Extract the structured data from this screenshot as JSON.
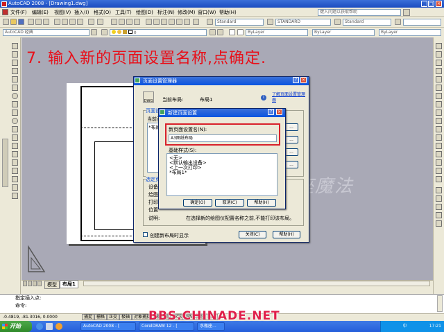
{
  "app": {
    "title": "AutoCAD 2008 - [Drawing1.dwg]",
    "search_placeholder": "键入问题以获取帮助"
  },
  "menu": [
    "文件(F)",
    "编辑(E)",
    "视图(V)",
    "插入(I)",
    "格式(O)",
    "工具(T)",
    "绘图(D)",
    "标注(N)",
    "修改(M)",
    "窗口(W)",
    "帮助(H)"
  ],
  "toolbar2": {
    "workspace": "AutoCAD 经典",
    "layer": "ByLayer",
    "style1": "Standard",
    "style2": "STANDARD",
    "style3": "Standard",
    "linetype": "ByLayer",
    "lineweight": "ByLayer"
  },
  "heading": "7. 输入新的页面设置名称,点确定.",
  "page_setup_dialog": {
    "title": "页面设置管理器",
    "current_layout_label": "当前布局:",
    "current_layout_value": "布局1",
    "help_link": "了解页面设置管理器",
    "page_setup_group": "页面设置",
    "current_page_setup_label": "当前页",
    "list_item": "*布局",
    "side_buttons": [
      "...",
      "...",
      "...",
      "..."
    ],
    "selected_group": "选定页面设置的详细信息",
    "details": [
      "设备名",
      "绘图仪",
      "打印",
      "位置",
      "说明:"
    ],
    "description_text": "在选择新的绘图仪配置名称之前,不能打印该布局。",
    "checkbox_label": "创建新布局时显示",
    "close_button": "关闭(C)",
    "help_button": "帮助(H)"
  },
  "new_page_setup_dialog": {
    "title": "新建页面设置",
    "name_label": "新页面设置名(N):",
    "name_value": "A3图纸布局",
    "base_label": "基础样式(S):",
    "options": [
      "<无>",
      "<默认输出设备>",
      "<上一次打印>",
      "*布局1*"
    ],
    "ok_button": "确定(O)",
    "cancel_button": "取消(C)",
    "help_button": "帮助(H)"
  },
  "canvas_watermark": "水瓶座魔法",
  "tabs": [
    "模型",
    "布局1"
  ],
  "command": {
    "line1": "指定插入点:",
    "line2": "命令:"
  },
  "status": {
    "coords": "-0.4819, -81.3016, 0.0000",
    "buttons": [
      "捕捉",
      "栅格",
      "正交",
      "极轴",
      "对象捕捉",
      "对象追踪",
      "DUCS",
      "DYN",
      "线宽",
      "图纸"
    ]
  },
  "taskbar": {
    "start": "开始",
    "tasks": [
      "AutoCAD 2008 - [",
      "CorelDRAW 12 - [",
      "水瓶座..."
    ],
    "ime": "中",
    "time": "17:21"
  },
  "site_watermark": "BBS.CHINADE.NET"
}
